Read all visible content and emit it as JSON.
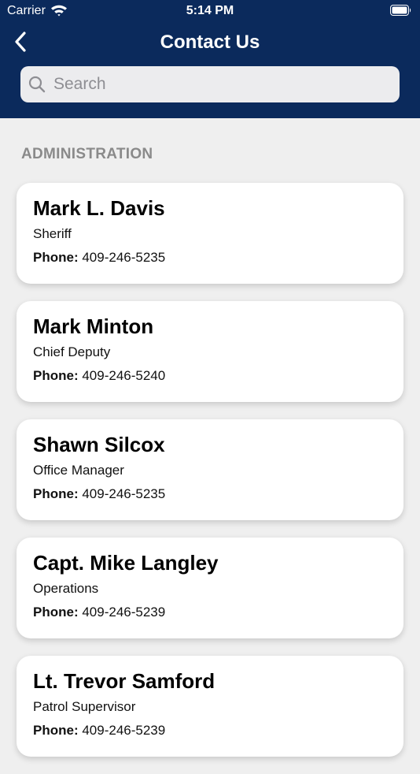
{
  "status_bar": {
    "carrier": "Carrier",
    "time": "5:14 PM"
  },
  "nav": {
    "title": "Contact Us",
    "back_icon": "chevron-left-icon"
  },
  "search": {
    "placeholder": "Search",
    "value": ""
  },
  "section": {
    "header": "ADMINISTRATION"
  },
  "contacts": [
    {
      "name": "Mark L. Davis",
      "title": "Sheriff",
      "phone_label": "Phone:",
      "phone": "409-246-5235"
    },
    {
      "name": "Mark Minton",
      "title": "Chief Deputy",
      "phone_label": "Phone:",
      "phone": "409-246-5240"
    },
    {
      "name": "Shawn Silcox",
      "title": "Office Manager",
      "phone_label": "Phone:",
      "phone": "409-246-5235"
    },
    {
      "name": "Capt. Mike Langley",
      "title": "Operations",
      "phone_label": "Phone:",
      "phone": "409-246-5239"
    },
    {
      "name": "Lt. Trevor Samford",
      "title": "Patrol Supervisor",
      "phone_label": "Phone:",
      "phone": "409-246-5239"
    }
  ],
  "colors": {
    "header_bg": "#0b2a5c",
    "page_bg": "#efefef",
    "card_bg": "#ffffff",
    "section_text": "#8a8a8a"
  }
}
